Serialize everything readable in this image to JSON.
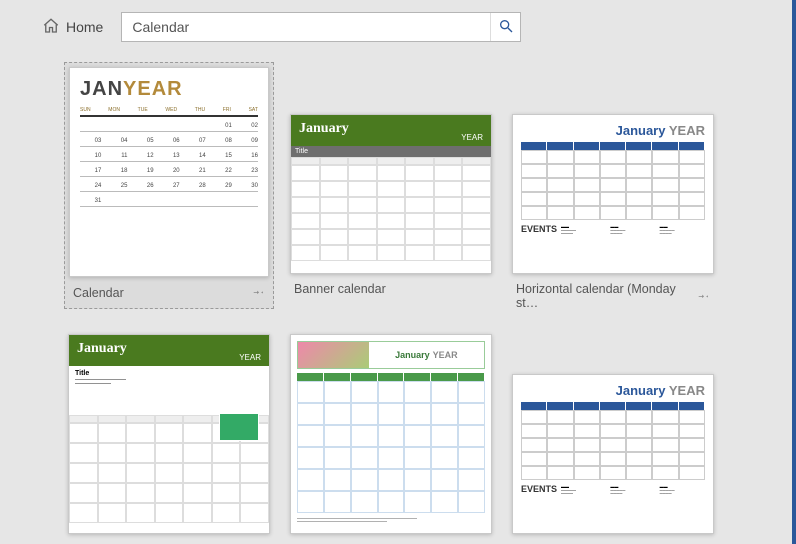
{
  "nav": {
    "home": "Home"
  },
  "search": {
    "value": "Calendar"
  },
  "templates": [
    {
      "label": "Calendar",
      "selected": true,
      "pinned": true,
      "style": "t1",
      "month": "JAN",
      "year": "YEAR",
      "days": [
        "SUN",
        "MON",
        "TUE",
        "WED",
        "THU",
        "FRI",
        "SAT"
      ]
    },
    {
      "label": "Banner calendar",
      "selected": false,
      "pinned": false,
      "style": "tb-green-land",
      "month": "January",
      "year": "YEAR",
      "title": "Title"
    },
    {
      "label": "Horizontal calendar (Monday st…",
      "selected": false,
      "pinned": true,
      "style": "tb-blue-land",
      "month": "January",
      "year": "YEAR",
      "events": "EVENTS"
    },
    {
      "label": "",
      "selected": false,
      "pinned": false,
      "style": "tb-green-port",
      "month": "January",
      "year": "YEAR",
      "title": "Title"
    },
    {
      "label": "",
      "selected": false,
      "pinned": false,
      "style": "t5",
      "month": "January",
      "year": "YEAR"
    },
    {
      "label": "",
      "selected": false,
      "pinned": false,
      "style": "tb-blue-land",
      "month": "January",
      "year": "YEAR",
      "events": "EVENTS"
    }
  ]
}
